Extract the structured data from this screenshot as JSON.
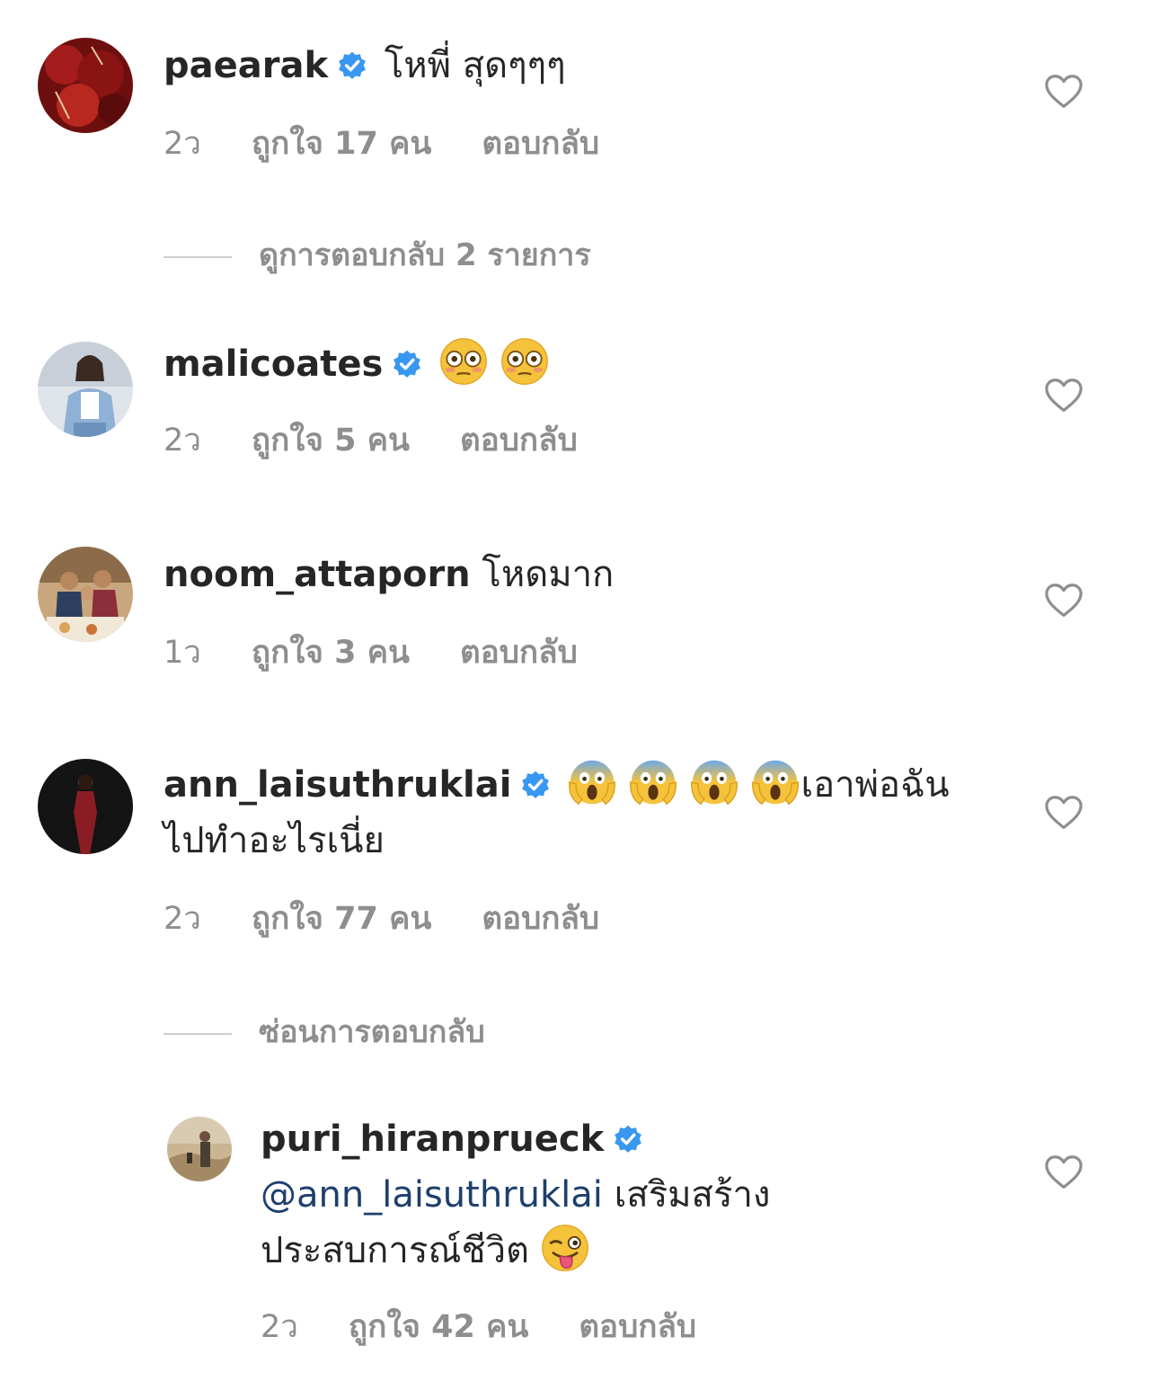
{
  "comments": [
    {
      "username": "paearak",
      "verified": true,
      "text": "โหพี่ สุดๆๆๆ",
      "time": "2ว",
      "likes": "ถูกใจ 17 คน",
      "reply": "ตอบกลับ"
    },
    {
      "username": "malicoates",
      "verified": true,
      "text": "",
      "emojis": [
        "flushed-face-emoji",
        "flushed-face-emoji"
      ],
      "time": "2ว",
      "likes": "ถูกใจ 5 คน",
      "reply": "ตอบกลับ"
    },
    {
      "username": "noom_attaporn",
      "verified": false,
      "text": "โหดมาก",
      "time": "1ว",
      "likes": "ถูกใจ 3 คน",
      "reply": "ตอบกลับ"
    },
    {
      "username": "ann_laisuthruklai",
      "verified": true,
      "emojis": [
        "screaming-face-emoji",
        "screaming-face-emoji",
        "screaming-face-emoji",
        "screaming-face-emoji"
      ],
      "text": "เอาพ่อฉันไปทำอะไรเนี่ย",
      "time": "2ว",
      "likes": "ถูกใจ 77 คน",
      "reply": "ตอบกลับ"
    }
  ],
  "reply": {
    "username": "puri_hiranprueck",
    "verified": true,
    "mention": "@ann_laisuthruklai",
    "text_line1": "เสริมสร้าง",
    "text_line2": "ประสบการณ์ชีวิต",
    "emojis": [
      "winking-tongue-face-emoji"
    ],
    "time": "2ว",
    "likes": "ถูกใจ 42 คน",
    "reply": "ตอบกลับ"
  },
  "thread_toggles": {
    "view_replies": "ดูการตอบกลับ 2 รายการ",
    "hide_replies": "ซ่อนการตอบกลับ"
  },
  "colors": {
    "verified_badge": "#3897f0",
    "meta_text": "#8e8e8e",
    "mention": "#1e3f6e",
    "heart_outline": "#8e8e8e"
  }
}
